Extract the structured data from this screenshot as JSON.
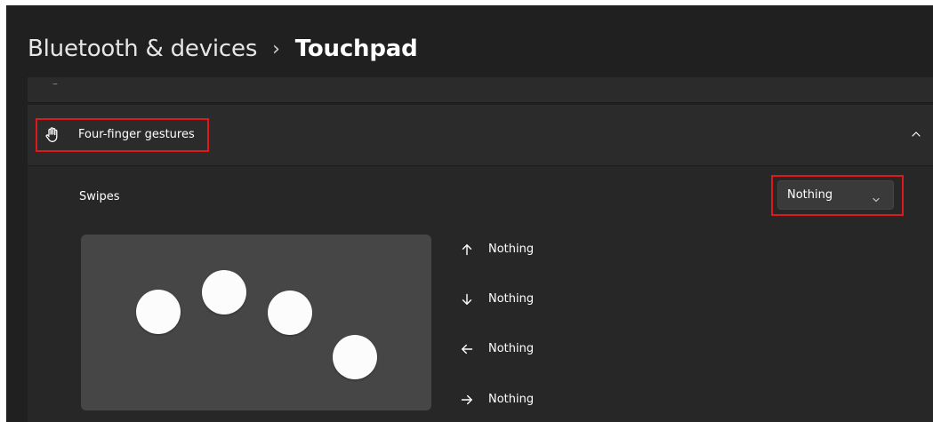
{
  "breadcrumb": {
    "parent": "Bluetooth & devices",
    "separator": "›",
    "current": "Touchpad"
  },
  "previous_section": {
    "partial_glyph": "–"
  },
  "section": {
    "title": "Four-finger gestures",
    "icon": "hand-icon",
    "expanded": true
  },
  "swipes": {
    "label": "Swipes",
    "dropdown_value": "Nothing",
    "directions": [
      {
        "icon": "arrow-up-icon",
        "value": "Nothing"
      },
      {
        "icon": "arrow-down-icon",
        "value": "Nothing"
      },
      {
        "icon": "arrow-left-icon",
        "value": "Nothing"
      },
      {
        "icon": "arrow-right-icon",
        "value": "Nothing"
      }
    ]
  },
  "colors": {
    "background": "#202020",
    "card": "#2b2b2b",
    "expanded_body": "#272727",
    "touchpad": "#464646",
    "finger": "#fcfcfc",
    "highlight": "#e01818"
  }
}
